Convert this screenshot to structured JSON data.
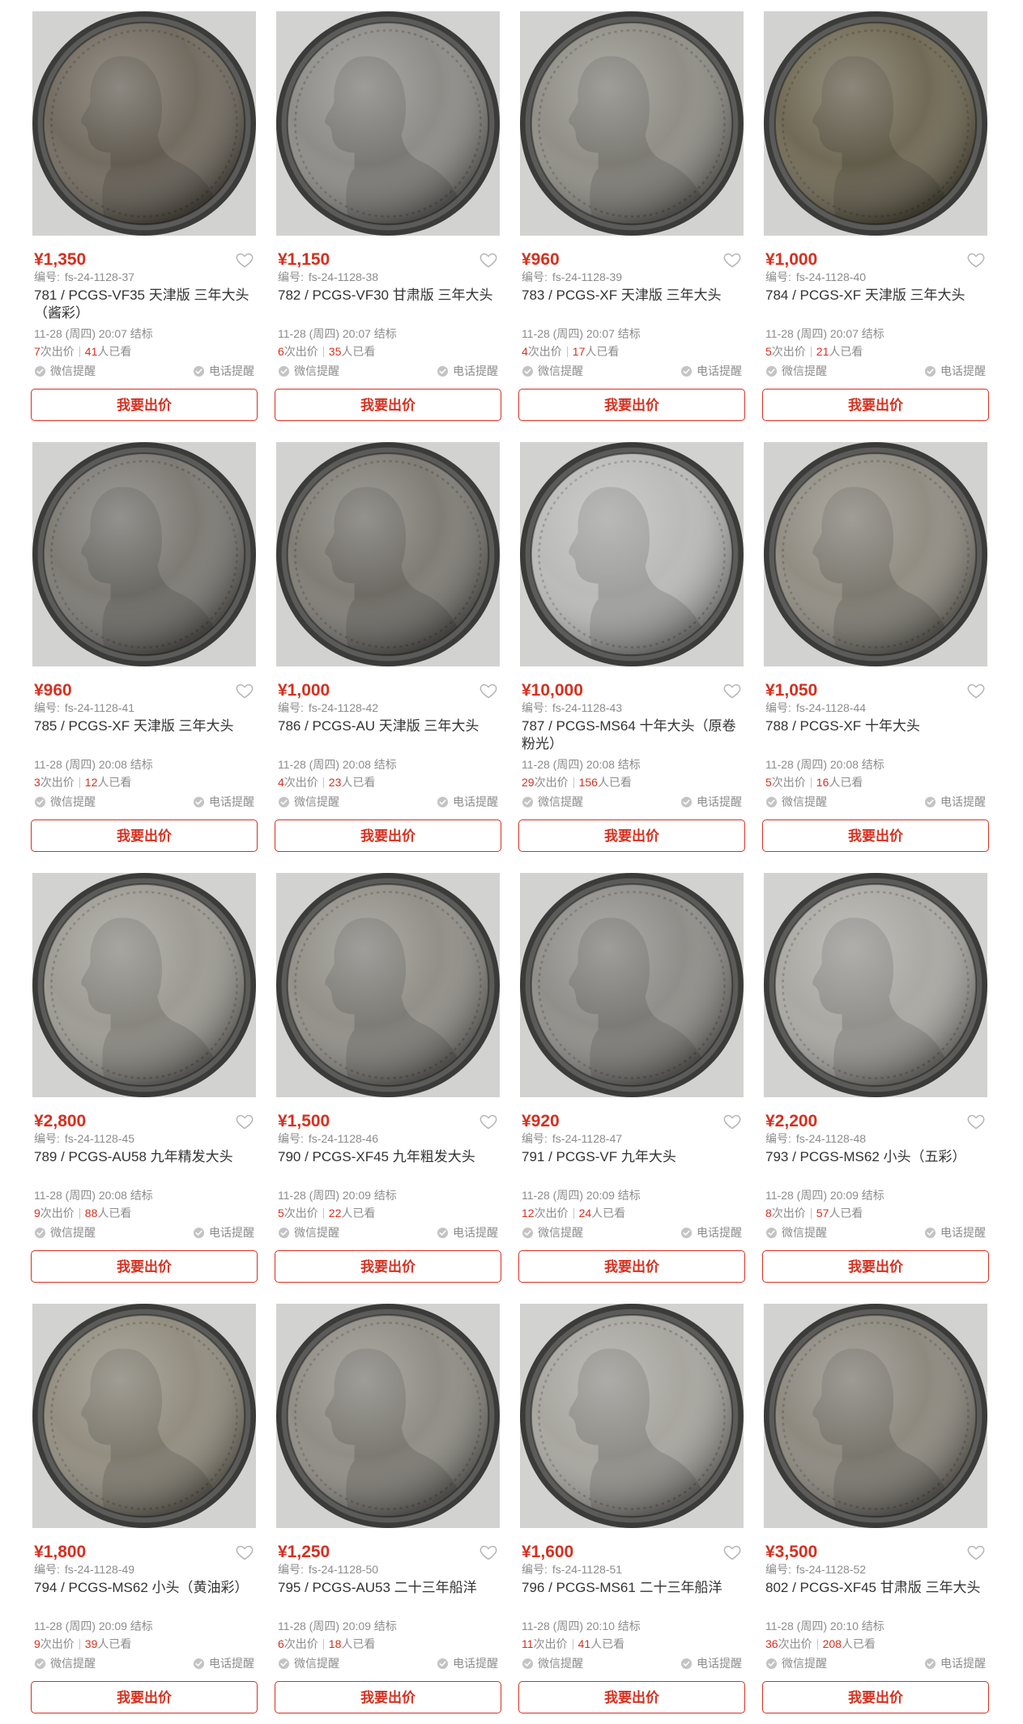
{
  "theme": {
    "accent": "#d6301f",
    "text": "#333333",
    "muted": "#8c8c8c"
  },
  "labels": {
    "code_prefix": "编号:",
    "bids_suffix": "次出价",
    "views_suffix": "人已看",
    "wechat_remind": "微信提醒",
    "phone_remind": "电话提醒",
    "bid_button": "我要出价"
  },
  "icons": {
    "favorite": "heart-icon",
    "reminder": "check-circle-icon"
  },
  "listing": {
    "items": [
      {
        "price": "¥1,350",
        "code": "fs-24-1128-37",
        "title": "781 / PCGS-VF35 天津版 三年大头（酱彩）",
        "end_time": "11-28 (周四) 20:07 结标",
        "bids": "7",
        "views": "41",
        "coin_tone": "#6f685d"
      },
      {
        "price": "¥1,150",
        "code": "fs-24-1128-38",
        "title": "782 / PCGS-VF30 甘肃版 三年大头",
        "end_time": "11-28 (周四) 20:07 结标",
        "bids": "6",
        "views": "35",
        "coin_tone": "#8b8a85"
      },
      {
        "price": "¥960",
        "code": "fs-24-1128-39",
        "title": "783 / PCGS-XF 天津版 三年大头",
        "end_time": "11-28 (周四) 20:07 结标",
        "bids": "4",
        "views": "17",
        "coin_tone": "#8e8c84"
      },
      {
        "price": "¥1,000",
        "code": "fs-24-1128-40",
        "title": "784 / PCGS-XF 天津版 三年大头",
        "end_time": "11-28 (周四) 20:07 结标",
        "bids": "5",
        "views": "21",
        "coin_tone": "#6e6752"
      },
      {
        "price": "¥960",
        "code": "fs-24-1128-41",
        "title": "785 / PCGS-XF 天津版 三年大头",
        "end_time": "11-28 (周四) 20:08 结标",
        "bids": "3",
        "views": "12",
        "coin_tone": "#7b7872"
      },
      {
        "price": "¥1,000",
        "code": "fs-24-1128-42",
        "title": "786 / PCGS-AU 天津版 三年大头",
        "end_time": "11-28 (周四) 20:08 结标",
        "bids": "4",
        "views": "23",
        "coin_tone": "#7d7a73"
      },
      {
        "price": "¥10,000",
        "code": "fs-24-1128-43",
        "title": "787 / PCGS-MS64 十年大头（原卷粉光）",
        "end_time": "11-28 (周四) 20:08 结标",
        "bids": "29",
        "views": "156",
        "coin_tone": "#b9b9b7"
      },
      {
        "price": "¥1,050",
        "code": "fs-24-1128-44",
        "title": "788 / PCGS-XF 十年大头",
        "end_time": "11-28 (周四) 20:08 结标",
        "bids": "5",
        "views": "16",
        "coin_tone": "#8f8b81"
      },
      {
        "price": "¥2,800",
        "code": "fs-24-1128-45",
        "title": "789 / PCGS-AU58 九年精发大头",
        "end_time": "11-28 (周四) 20:08 结标",
        "bids": "9",
        "views": "88",
        "coin_tone": "#9b9991"
      },
      {
        "price": "¥1,500",
        "code": "fs-24-1128-46",
        "title": "790 / PCGS-XF45 九年粗发大头",
        "end_time": "11-28 (周四) 20:09 结标",
        "bids": "5",
        "views": "22",
        "coin_tone": "#908d86"
      },
      {
        "price": "¥920",
        "code": "fs-24-1128-47",
        "title": "791 / PCGS-VF 九年大头",
        "end_time": "11-28 (周四) 20:09 结标",
        "bids": "12",
        "views": "24",
        "coin_tone": "#8e8c87"
      },
      {
        "price": "¥2,200",
        "code": "fs-24-1128-48",
        "title": "793 / PCGS-MS62 小头（五彩）",
        "end_time": "11-28 (周四) 20:09 结标",
        "bids": "8",
        "views": "57",
        "coin_tone": "#a9a7a1"
      },
      {
        "price": "¥1,800",
        "code": "fs-24-1128-49",
        "title": "794 / PCGS-MS62 小头（黄油彩）",
        "end_time": "11-28 (周四) 20:09 结标",
        "bids": "9",
        "views": "39",
        "coin_tone": "#908b7d"
      },
      {
        "price": "¥1,250",
        "code": "fs-24-1128-50",
        "title": "795 / PCGS-AU53 二十三年船洋",
        "end_time": "11-28 (周四) 20:09 结标",
        "bids": "6",
        "views": "18",
        "coin_tone": "#8e8b83"
      },
      {
        "price": "¥1,600",
        "code": "fs-24-1128-51",
        "title": "796 / PCGS-MS61 二十三年船洋",
        "end_time": "11-28 (周四) 20:10 结标",
        "bids": "11",
        "views": "41",
        "coin_tone": "#a6a49d"
      },
      {
        "price": "¥3,500",
        "code": "fs-24-1128-52",
        "title": "802 / PCGS-XF45 甘肃版 三年大头",
        "end_time": "11-28 (周四) 20:10 结标",
        "bids": "36",
        "views": "208",
        "coin_tone": "#8b877d"
      }
    ]
  }
}
